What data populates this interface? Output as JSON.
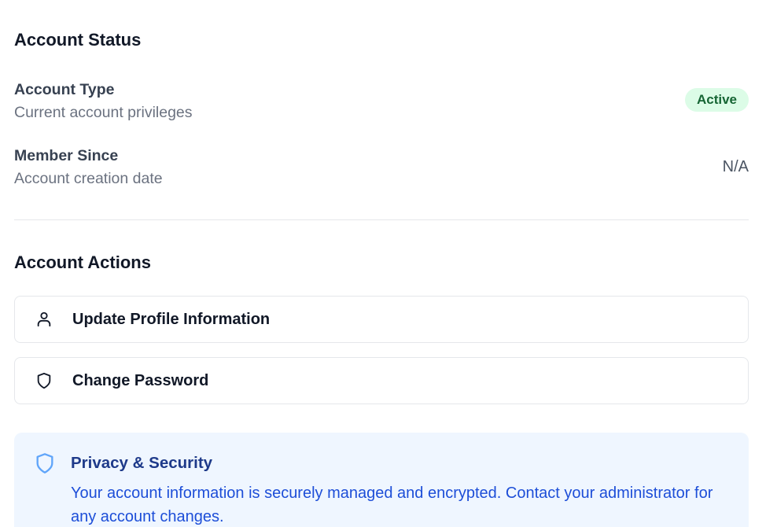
{
  "account_status": {
    "title": "Account Status",
    "account_type": {
      "label": "Account Type",
      "description": "Current account privileges",
      "badge": "Active",
      "badge_color": "#166534",
      "badge_bg": "#dcfce7"
    },
    "member_since": {
      "label": "Member Since",
      "description": "Account creation date",
      "value": "N/A"
    }
  },
  "account_actions": {
    "title": "Account Actions",
    "items": [
      {
        "label": "Update Profile Information",
        "icon": "user-icon"
      },
      {
        "label": "Change Password",
        "icon": "shield-icon"
      }
    ]
  },
  "privacy": {
    "icon": "shield-icon",
    "title": "Privacy & Security",
    "text": "Your account information is securely managed and encrypted. Contact your administrator for any account changes.",
    "accent_color": "#1d4ed8",
    "background": "#eff6ff"
  }
}
